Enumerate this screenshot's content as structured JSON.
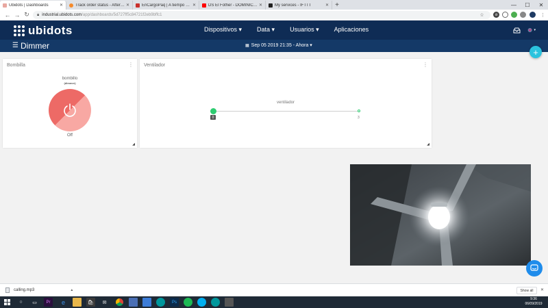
{
  "browser": {
    "tabs": [
      {
        "label": "Ubidots | Dashboards",
        "color": "#e8a7a0",
        "active": true
      },
      {
        "label": "Track order status - AfterShip",
        "color": "#f58a2b",
        "active": false
      },
      {
        "label": "EnCargoPaq | A tiempo en tu P...",
        "color": "#c9302c",
        "active": false
      },
      {
        "label": "DS El Fother - DOMINICAN Gau...",
        "color": "#ff0000",
        "active": false
      },
      {
        "label": "My services - IFTTT",
        "color": "#222222",
        "active": false
      }
    ],
    "new_tab": "+",
    "window_controls": {
      "minimize": "—",
      "maximize": "☐",
      "close": "✕"
    },
    "address": {
      "host": "industrial.ubidots.com",
      "path": "/app/dashboards/5d727ff5c84721f2eb9bffc1"
    }
  },
  "header": {
    "logo": "ubidots",
    "nav": [
      "Dispositivos ▾",
      "Data ▾",
      "Usuarios ▾",
      "Aplicaciones"
    ]
  },
  "dashboard": {
    "title": "Dimmer",
    "date_range": "Sep 05 2019 21:35 - Ahora ▾",
    "add_button": "+"
  },
  "widgets": {
    "bombilla": {
      "title": "Bombilla",
      "variable": "bombillo",
      "device": "(dimmer)",
      "state": "Off",
      "colors": {
        "dark": "#ed6a66",
        "light": "#f8a8a3"
      }
    },
    "ventilador": {
      "title": "Ventilador",
      "variable": "ventilador",
      "min": "0",
      "max": "3",
      "value": 0
    }
  },
  "downloads": {
    "file": "calling.mp3",
    "show_all": "Show all",
    "close": "✕"
  },
  "taskbar": {
    "time": "9:36",
    "date": "06/09/2019"
  }
}
